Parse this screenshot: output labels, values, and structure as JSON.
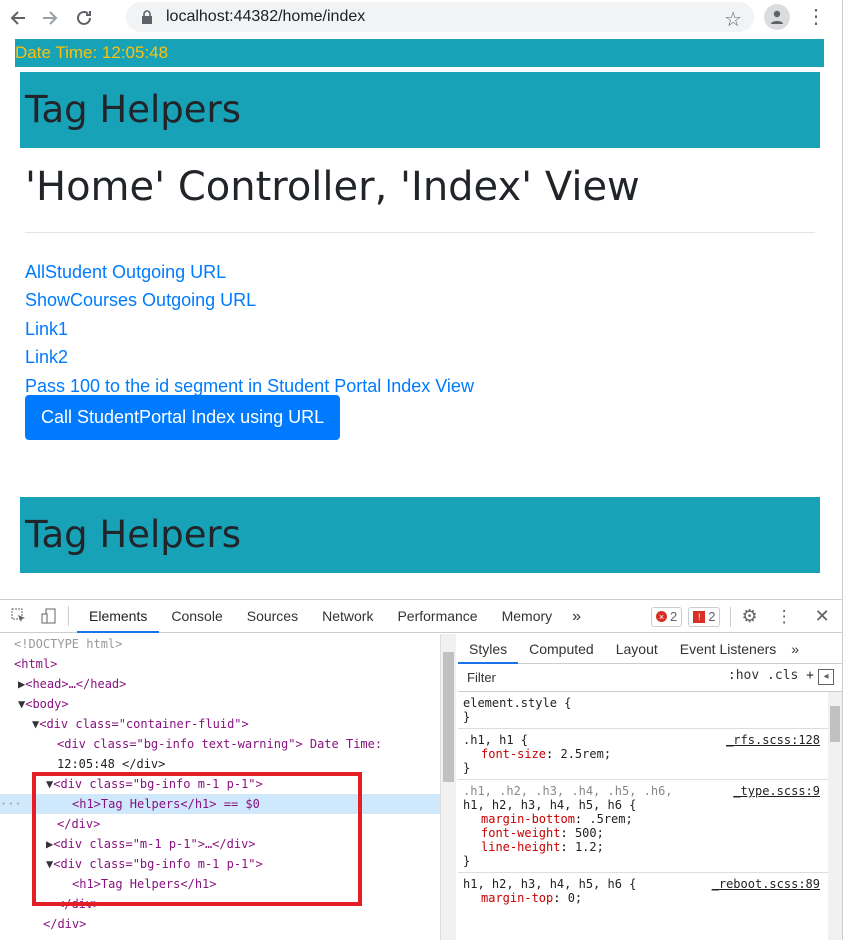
{
  "browser": {
    "url": "localhost:44382/home/index"
  },
  "page": {
    "datetime": "Date Time: 12:05:48",
    "heading_top": "Tag Helpers",
    "view_title": "'Home' Controller, 'Index' View",
    "links": [
      "AllStudent Outgoing URL",
      "ShowCourses Outgoing URL",
      "Link1",
      "Link2",
      "Pass 100 to the id segment in Student Portal Index View"
    ],
    "button_label": "Call StudentPortal Index using URL",
    "heading_bottom": "Tag Helpers"
  },
  "devtools": {
    "tabs": [
      "Elements",
      "Console",
      "Sources",
      "Network",
      "Performance",
      "Memory"
    ],
    "more": "»",
    "error_count": "2",
    "issue_count": "2",
    "elements_lines": [
      "<!DOCTYPE html>",
      "<html>",
      "<head>…</head>",
      "<body>",
      "<div class=\"container-fluid\">",
      "<div class=\"bg-info text-warning\"> Date Time:",
      "12:05:48 </div>",
      "<div class=\"bg-info m-1 p-1\">",
      "<h1>Tag Helpers</h1> == $0",
      "</div>",
      "<div class=\"m-1 p-1\">…</div>",
      "<div class=\"bg-info m-1 p-1\">",
      "<h1>Tag Helpers</h1>",
      "</div>",
      "</div>"
    ],
    "styles_tabs": [
      "Styles",
      "Computed",
      "Layout",
      "Event Listeners"
    ],
    "filter_placeholder": "Filter",
    "filter_tools": ":hov  .cls  +",
    "rules": [
      {
        "selector": "element.style {",
        "source": "",
        "props": [],
        "close": "}"
      },
      {
        "selector": ".h1, h1 {",
        "source": "_rfs.scss:128",
        "props": [
          [
            "font-size",
            "2.5rem;"
          ]
        ],
        "close": "}"
      },
      {
        "selector": ".h1, .h2, .h3, .h4, .h5, .h6,",
        "selector2": "h1, h2, h3, h4, h5, h6 {",
        "source": "_type.scss:9",
        "props": [
          [
            "margin-bottom",
            ".5rem;"
          ],
          [
            "font-weight",
            "500;"
          ],
          [
            "line-height",
            "1.2;"
          ]
        ],
        "close": "}"
      },
      {
        "selector": "h1, h2, h3, h4, h5, h6 {",
        "source": "_reboot.scss:89",
        "props": [
          [
            "margin-top",
            "0;"
          ]
        ],
        "close": ""
      }
    ]
  }
}
